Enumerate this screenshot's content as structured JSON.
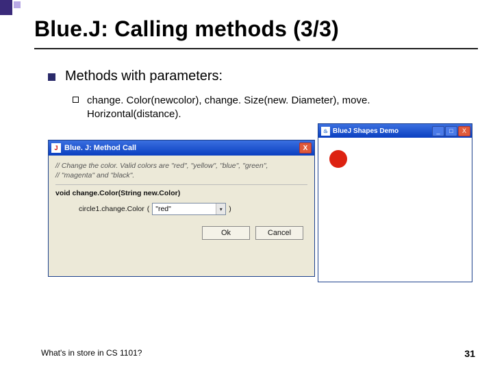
{
  "slide": {
    "title": "Blue.J: Calling methods (3/3)",
    "bullet1": "Methods with parameters:",
    "bullet2": "change. Color(newcolor), change. Size(new. Diameter), move. Horizontal(distance).",
    "footer_left": "What's in store in CS 1101?",
    "page_number": "31"
  },
  "dialog": {
    "icon_glyph": "J",
    "title": "Blue. J:  Method Call",
    "close_glyph": "X",
    "comment_line1": "// Change the color. Valid colors are \"red\", \"yellow\", \"blue\", \"green\",",
    "comment_line2": "// \"magenta\" and \"black\".",
    "signature": "void change.Color(String new.Color)",
    "call_prefix": "circle1.change.Color",
    "open_paren": "(",
    "close_paren": ")",
    "input_value": "\"red\"",
    "combo_arrow": "▾",
    "ok_label": "Ok",
    "cancel_label": "Cancel"
  },
  "shapes": {
    "icon_glyph": "♨",
    "title": "BlueJ Shapes Demo",
    "min_glyph": "_",
    "max_glyph": "□",
    "close_glyph": "X",
    "circle_color": "#d21"
  }
}
